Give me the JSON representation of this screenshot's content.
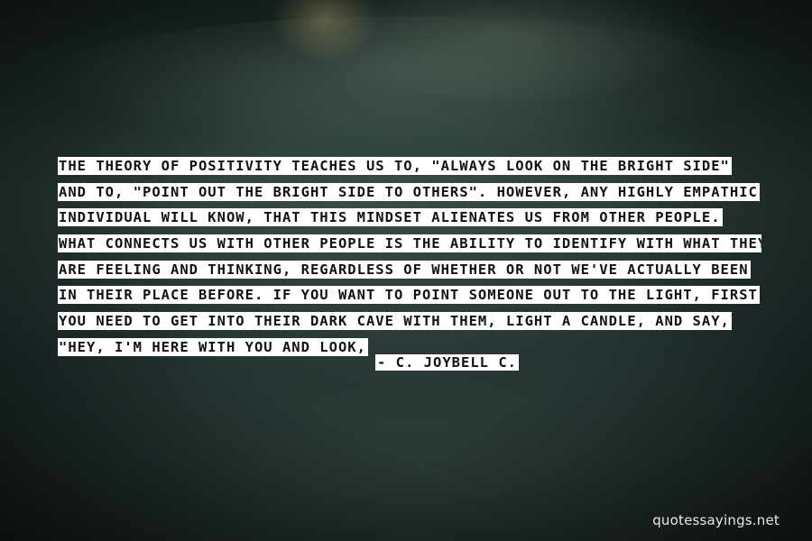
{
  "quote": {
    "lines": [
      "THE THEORY OF POSITIVITY TEACHES US TO, \"ALWAYS LOOK ON THE BRIGHT SIDE\"",
      "AND TO, \"POINT OUT THE BRIGHT SIDE TO OTHERS\". HOWEVER, ANY HIGHLY EMPATHIC",
      "INDIVIDUAL WILL KNOW, THAT THIS MINDSET ALIENATES US FROM OTHER PEOPLE.",
      "WHAT CONNECTS US WITH OTHER PEOPLE IS THE ABILITY TO IDENTIFY WITH WHAT THEY",
      "ARE FEELING AND THINKING, REGARDLESS OF WHETHER OR NOT WE'VE ACTUALLY BEEN",
      "IN THEIR PLACE BEFORE. IF YOU WANT TO POINT SOMEONE OUT TO THE LIGHT, FIRST",
      "YOU NEED TO GET INTO THEIR DARK CAVE WITH THEM, LIGHT A CANDLE, AND SAY,",
      "\"HEY, I'M HERE WITH YOU AND LOOK,"
    ],
    "author": "- C. JOYBELL C."
  },
  "watermark": "quotessayings.net",
  "colors": {
    "text_highlight": "#ffffff",
    "text": "#111111",
    "watermark": "#e8e8e8"
  }
}
